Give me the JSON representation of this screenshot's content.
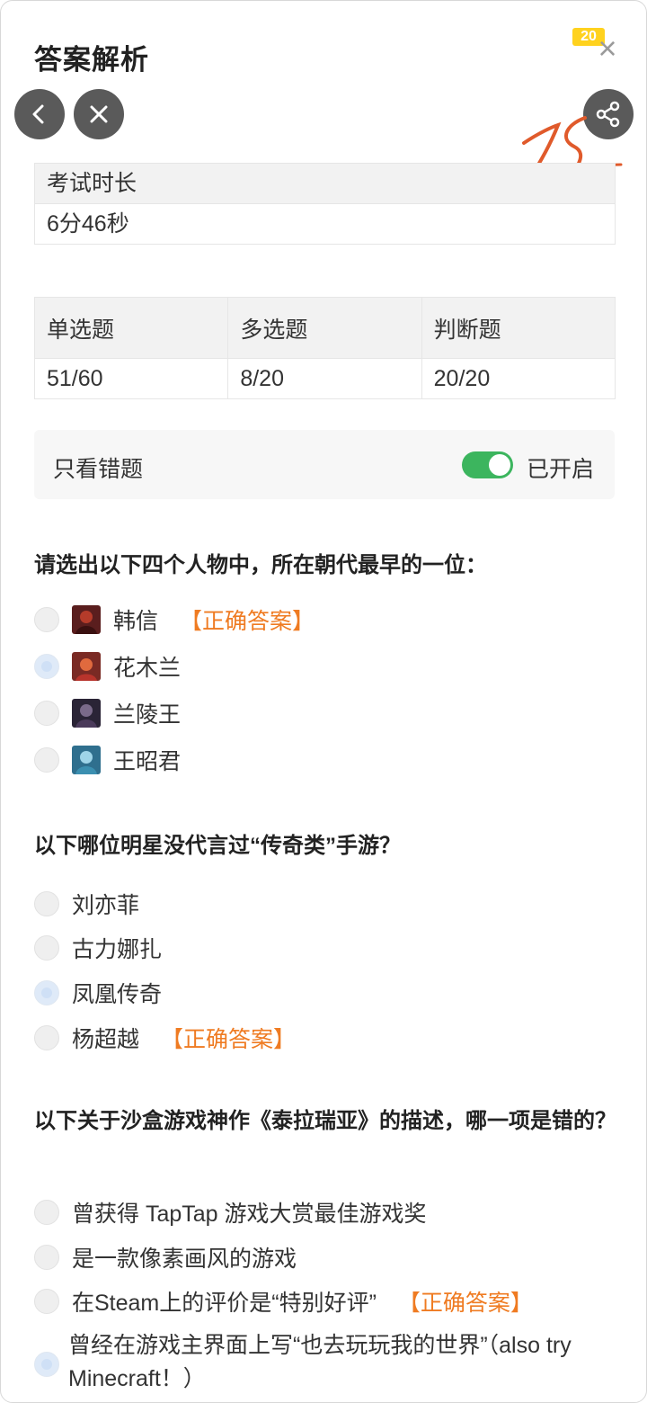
{
  "header": {
    "title": "答案解析",
    "badge_count": "20",
    "close_icon": "close-icon",
    "back_icon": "chevron-left-icon",
    "dismiss_icon": "close-circle-icon",
    "share_icon": "share-icon"
  },
  "duration": {
    "label": "考试时长",
    "value": "6分46秒"
  },
  "scores": {
    "headers": [
      "单选题",
      "多选题",
      "判断题"
    ],
    "values": [
      "51/60",
      "8/20",
      "20/20"
    ]
  },
  "filter": {
    "label": "只看错题",
    "state": "已开启",
    "enabled": true,
    "accent": "#3cb55e"
  },
  "correct_tag": "【正确答案】",
  "questions": [
    {
      "text": "请选出以下四个人物中，所在朝代最早的一位：",
      "options": [
        {
          "label": "韩信",
          "selected": false,
          "correct": true
        },
        {
          "label": "花木兰",
          "selected": true,
          "correct": false
        },
        {
          "label": "兰陵王",
          "selected": false,
          "correct": false
        },
        {
          "label": "王昭君",
          "selected": false,
          "correct": false
        }
      ]
    },
    {
      "text": "以下哪位明星没代言过“传奇类”手游？",
      "options": [
        {
          "label": "刘亦菲",
          "selected": false,
          "correct": false
        },
        {
          "label": "古力娜扎",
          "selected": false,
          "correct": false
        },
        {
          "label": "凤凰传奇",
          "selected": true,
          "correct": false
        },
        {
          "label": "杨超越",
          "selected": false,
          "correct": true
        }
      ]
    },
    {
      "text": "以下关于沙盒游戏神作《泰拉瑞亚》的描述，哪一项是错的？",
      "options": [
        {
          "label": "曾获得 TapTap 游戏大赏最佳游戏奖",
          "selected": false,
          "correct": false
        },
        {
          "label": "是一款像素画风的游戏",
          "selected": false,
          "correct": false
        },
        {
          "label": "在Steam上的评价是“特别好评”",
          "selected": false,
          "correct": true
        },
        {
          "label": "曾经在游戏主界面上写“也去玩玩我的世界”（also try Minecraft！）",
          "selected": true,
          "correct": false
        }
      ]
    }
  ],
  "colors": {
    "correct_text": "#ef7b22",
    "button_bg": "#5a5a5a"
  }
}
